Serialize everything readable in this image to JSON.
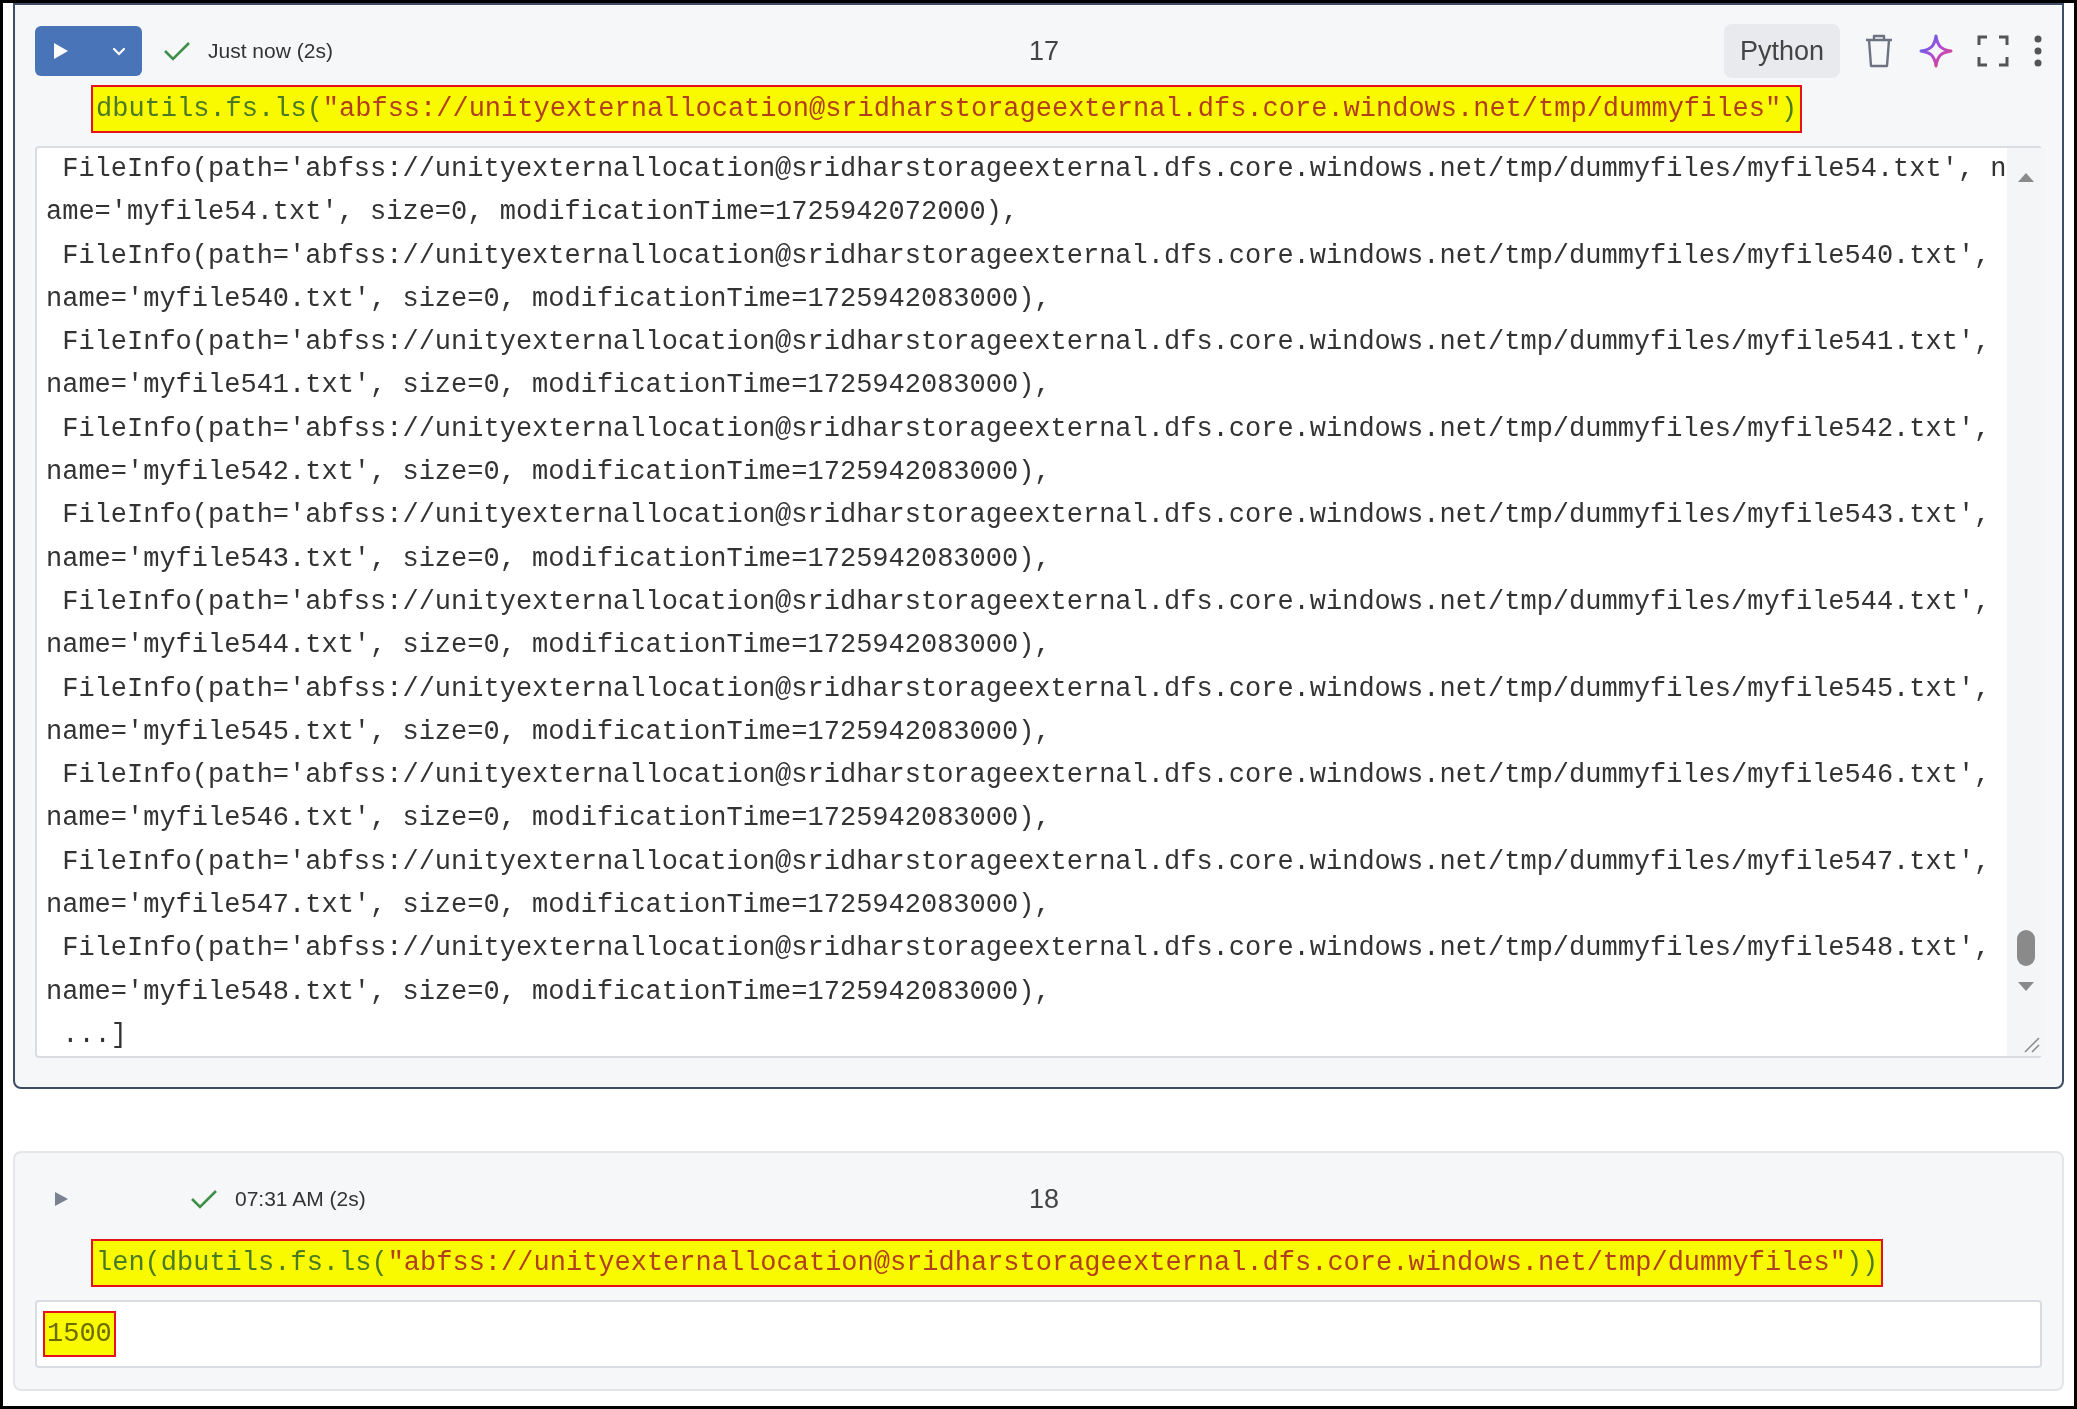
{
  "cells": [
    {
      "selected": true,
      "status": "Just now (2s)",
      "number": "17",
      "language": "Python",
      "code": {
        "highlighted": true,
        "tokens": [
          {
            "kind": "plain",
            "text": "dbutils.fs.ls("
          },
          {
            "kind": "string",
            "text": "\"abfss://unityexternallocation@sridharstorageexternal.dfs.core.windows.net/tmp/dummyfiles\""
          },
          {
            "kind": "plain",
            "text": ")"
          }
        ]
      },
      "output": {
        "kind": "scroll",
        "highlighted": false,
        "lines": [
          " FileInfo(path='abfss://unityexternallocation@sridharstorageexternal.dfs.core.windows.net/tmp/dummyfiles/myfile54.txt', n",
          "ame='myfile54.txt', size=0, modificationTime=1725942072000),",
          " FileInfo(path='abfss://unityexternallocation@sridharstorageexternal.dfs.core.windows.net/tmp/dummyfiles/myfile540.txt',",
          "name='myfile540.txt', size=0, modificationTime=1725942083000),",
          " FileInfo(path='abfss://unityexternallocation@sridharstorageexternal.dfs.core.windows.net/tmp/dummyfiles/myfile541.txt',",
          "name='myfile541.txt', size=0, modificationTime=1725942083000),",
          " FileInfo(path='abfss://unityexternallocation@sridharstorageexternal.dfs.core.windows.net/tmp/dummyfiles/myfile542.txt',",
          "name='myfile542.txt', size=0, modificationTime=1725942083000),",
          " FileInfo(path='abfss://unityexternallocation@sridharstorageexternal.dfs.core.windows.net/tmp/dummyfiles/myfile543.txt',",
          "name='myfile543.txt', size=0, modificationTime=1725942083000),",
          " FileInfo(path='abfss://unityexternallocation@sridharstorageexternal.dfs.core.windows.net/tmp/dummyfiles/myfile544.txt',",
          "name='myfile544.txt', size=0, modificationTime=1725942083000),",
          " FileInfo(path='abfss://unityexternallocation@sridharstorageexternal.dfs.core.windows.net/tmp/dummyfiles/myfile545.txt',",
          "name='myfile545.txt', size=0, modificationTime=1725942083000),",
          " FileInfo(path='abfss://unityexternallocation@sridharstorageexternal.dfs.core.windows.net/tmp/dummyfiles/myfile546.txt',",
          "name='myfile546.txt', size=0, modificationTime=1725942083000),",
          " FileInfo(path='abfss://unityexternallocation@sridharstorageexternal.dfs.core.windows.net/tmp/dummyfiles/myfile547.txt',",
          "name='myfile547.txt', size=0, modificationTime=1725942083000),",
          " FileInfo(path='abfss://unityexternallocation@sridharstorageexternal.dfs.core.windows.net/tmp/dummyfiles/myfile548.txt',",
          "name='myfile548.txt', size=0, modificationTime=1725942083000),",
          " ...]"
        ]
      }
    },
    {
      "selected": false,
      "status": "07:31 AM (2s)",
      "number": "18",
      "code": {
        "highlighted": true,
        "tokens": [
          {
            "kind": "plain",
            "text": "len(dbutils.fs.ls("
          },
          {
            "kind": "string",
            "text": "\"abfss://unityexternallocation@sridharstorageexternal.dfs.core.windows.net/tmp/dummyfiles\""
          },
          {
            "kind": "plain",
            "text": "))"
          }
        ]
      },
      "output": {
        "kind": "plain",
        "highlighted": true,
        "lines": [
          "1500"
        ]
      }
    }
  ]
}
